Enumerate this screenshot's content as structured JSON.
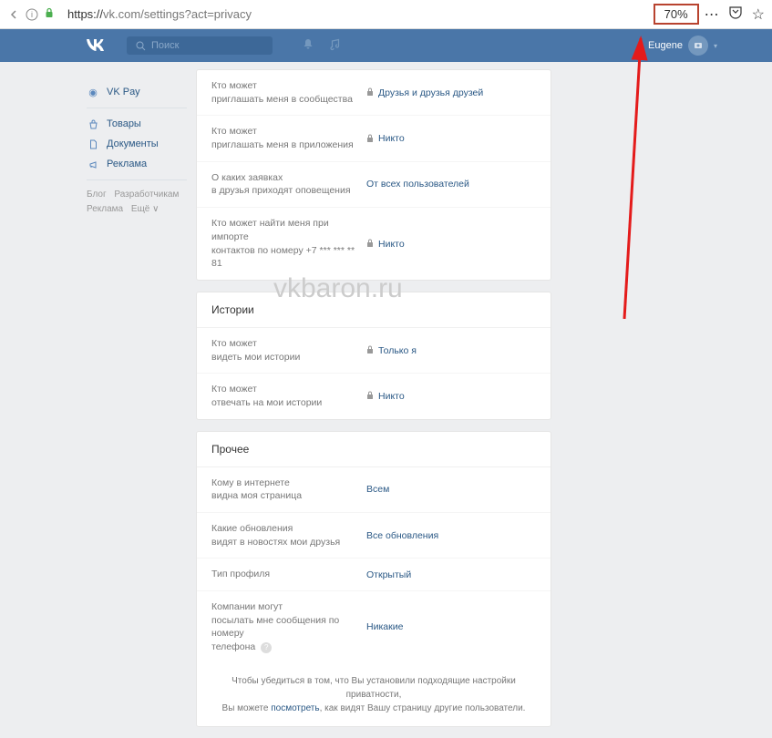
{
  "browser": {
    "url_prefix": "https://",
    "url": "vk.com/settings?act=privacy",
    "zoom": "70%"
  },
  "header": {
    "search_placeholder": "Поиск",
    "username": "Eugene"
  },
  "sidebar": {
    "items": [
      {
        "label": "VK Pay",
        "icon": "◉"
      },
      {
        "label": "Товары",
        "icon": "🛍"
      },
      {
        "label": "Документы",
        "icon": "📄"
      },
      {
        "label": "Реклама",
        "icon": "📢"
      }
    ],
    "footer_links": [
      "Блог",
      "Разработчикам",
      "Реклама",
      "Ещё ∨"
    ]
  },
  "sections": {
    "privacy": {
      "rows": [
        {
          "label": "Кто может\nприглашать меня в сообщества",
          "value": "Друзья и друзья друзей",
          "lock": true
        },
        {
          "label": "Кто может\nприглашать меня в приложения",
          "value": "Никто",
          "lock": true
        },
        {
          "label": "О каких заявках\nв друзья приходят оповещения",
          "value": "От всех пользователей",
          "lock": false
        },
        {
          "label": "Кто может найти меня при импорте\nконтактов по номеру +7 *** *** ** 81",
          "value": "Никто",
          "lock": true
        }
      ]
    },
    "stories": {
      "title": "Истории",
      "rows": [
        {
          "label": "Кто может\nвидеть мои истории",
          "value": "Только я",
          "lock": true
        },
        {
          "label": "Кто может\nотвечать на мои истории",
          "value": "Никто",
          "lock": true
        }
      ]
    },
    "other": {
      "title": "Прочее",
      "rows": [
        {
          "label": "Кому в интернете\nвидна моя страница",
          "value": "Всем",
          "lock": false
        },
        {
          "label": "Какие обновления\nвидят в новостях мои друзья",
          "value": "Все обновления",
          "lock": false
        },
        {
          "label": "Тип профиля",
          "value": "Открытый",
          "lock": false
        },
        {
          "label": "Компании могут\nпосылать мне сообщения по номеру\nтелефона",
          "value": "Никакие",
          "lock": false,
          "help": true
        }
      ]
    }
  },
  "footer": {
    "line1": "Чтобы убедиться в том, что Вы установили подходящие настройки приватности,",
    "line2_a": "Вы можете ",
    "link": "посмотреть",
    "line2_b": ", как видят Вашу страницу другие пользователи."
  },
  "watermark": "vkbaron.ru"
}
